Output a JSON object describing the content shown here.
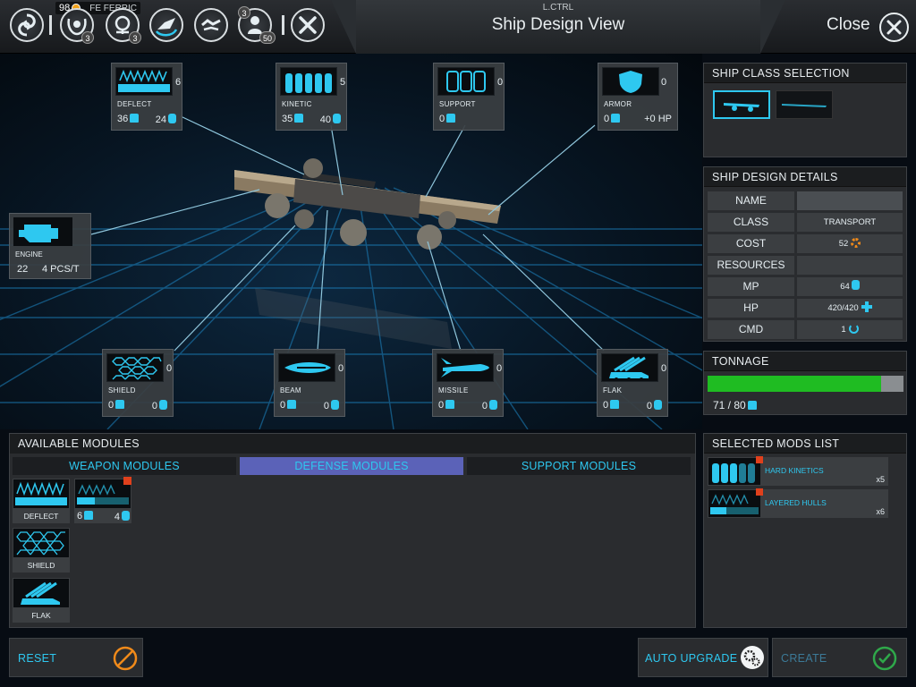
{
  "topbar": {
    "resource_value": "98",
    "resource_name": "FE FERRIC",
    "badges": {
      "fleet": "3",
      "influence": "3",
      "population": "50"
    },
    "hotkey": "L.CTRL",
    "title": "Ship Design View",
    "close_label": "Close"
  },
  "slots": {
    "deflect": {
      "label": "DEFLECT",
      "count": "6",
      "stat1": "36",
      "stat2": "24"
    },
    "kinetic": {
      "label": "KINETIC",
      "count": "5",
      "stat1": "35",
      "stat2": "40"
    },
    "support": {
      "label": "SUPPORT",
      "count": "0",
      "stat1": "0"
    },
    "armor": {
      "label": "ARMOR",
      "count": "0",
      "stat1": "0",
      "stat2": "+0 HP"
    },
    "engine": {
      "label": "ENGINE",
      "stat1": "22",
      "stat2": "4 PCS/T"
    },
    "shield": {
      "label": "SHIELD",
      "count": "0",
      "stat1": "0",
      "stat2": "0"
    },
    "beam": {
      "label": "BEAM",
      "count": "0",
      "stat1": "0",
      "stat2": "0"
    },
    "missile": {
      "label": "MISSILE",
      "count": "0",
      "stat1": "0",
      "stat2": "0"
    },
    "flak": {
      "label": "FLAK",
      "count": "0",
      "stat1": "0",
      "stat2": "0"
    }
  },
  "class_selection": {
    "heading": "SHIP CLASS SELECTION"
  },
  "details": {
    "heading": "SHIP DESIGN DETAILS",
    "rows": [
      {
        "key": "NAME",
        "value": ""
      },
      {
        "key": "CLASS",
        "value": "TRANSPORT"
      },
      {
        "key": "COST",
        "value": "52"
      },
      {
        "key": "RESOURCES",
        "value": ""
      },
      {
        "key": "MP",
        "value": "64"
      },
      {
        "key": "HP",
        "value": "420/420"
      },
      {
        "key": "CMD",
        "value": "1"
      }
    ]
  },
  "tonnage": {
    "heading": "TONNAGE",
    "used": 71,
    "max": 80,
    "text": "71 / 80"
  },
  "available": {
    "heading": "AVAILABLE MODULES",
    "tabs": [
      "WEAPON MODULES",
      "DEFENSE MODULES",
      "SUPPORT MODULES"
    ],
    "active_tab": 1,
    "cards": [
      {
        "label": "DEFLECT"
      },
      {
        "label": "",
        "stat1": "6",
        "stat2": "4"
      },
      {
        "label": "SHIELD"
      },
      {
        "label": "FLAK"
      }
    ]
  },
  "selected_mods": {
    "heading": "SELECTED MODS LIST",
    "items": [
      {
        "name": "HARD KINETICS",
        "qty": "x5"
      },
      {
        "name": "LAYERED HULLS",
        "qty": "x6"
      }
    ]
  },
  "buttons": {
    "reset": "RESET",
    "auto_upgrade": "AUTO UPGRADE",
    "create": "CREATE"
  },
  "colors": {
    "accent": "#2ec8f0",
    "tonnage_fill": "#1fbc22",
    "active_tab": "#5b62b8",
    "reset_icon": "#f08a1a",
    "create_icon": "#2fa84a"
  }
}
